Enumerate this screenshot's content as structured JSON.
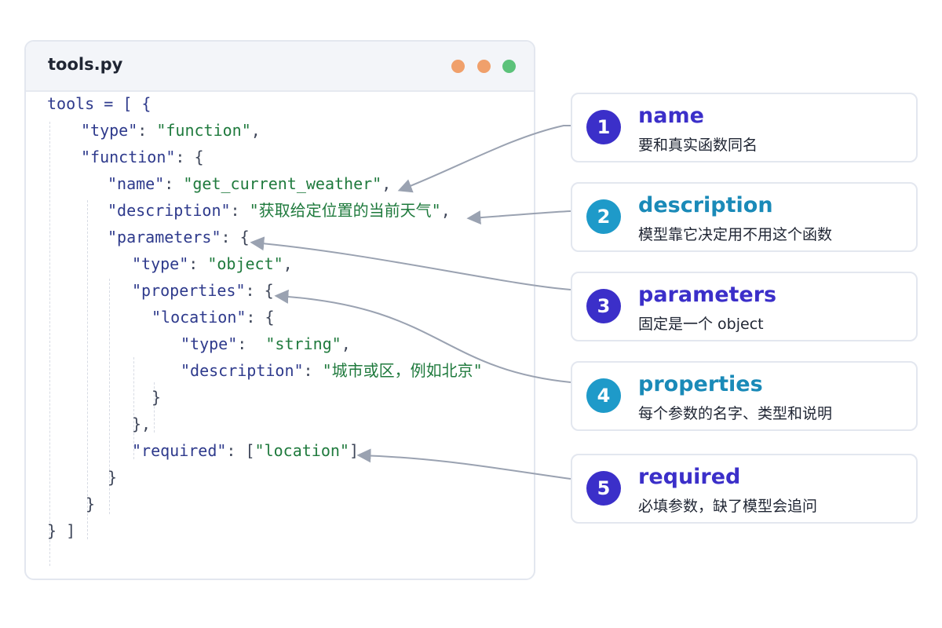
{
  "editor": {
    "filename": "tools.py",
    "window_dots": [
      "#f0a06b",
      "#f0a06b",
      "#5cc27a"
    ],
    "code_lines": [
      [
        {
          "t": "tools = [ {",
          "c": "key"
        }
      ],
      [
        {
          "t": "\"type\"",
          "c": "key"
        },
        {
          "t": ": ",
          "c": "pun"
        },
        {
          "t": "\"function\"",
          "c": "str"
        },
        {
          "t": ",",
          "c": "pun"
        }
      ],
      [
        {
          "t": "\"function\"",
          "c": "key"
        },
        {
          "t": ": {",
          "c": "pun"
        }
      ],
      [
        {
          "t": "\"name\"",
          "c": "key"
        },
        {
          "t": ": ",
          "c": "pun"
        },
        {
          "t": "\"get_current_weather\"",
          "c": "str"
        },
        {
          "t": ",",
          "c": "pun"
        }
      ],
      [
        {
          "t": "\"description\"",
          "c": "key"
        },
        {
          "t": ": ",
          "c": "pun"
        },
        {
          "t": "\"获取给定位置的当前天气\"",
          "c": "str"
        },
        {
          "t": ",",
          "c": "pun"
        }
      ],
      [
        {
          "t": "\"parameters\"",
          "c": "key"
        },
        {
          "t": ": {",
          "c": "pun"
        }
      ],
      [
        {
          "t": "\"type\"",
          "c": "key"
        },
        {
          "t": ": ",
          "c": "pun"
        },
        {
          "t": "\"object\"",
          "c": "str"
        },
        {
          "t": ",",
          "c": "pun"
        }
      ],
      [
        {
          "t": "\"properties\"",
          "c": "key"
        },
        {
          "t": ": {",
          "c": "pun"
        }
      ],
      [
        {
          "t": "\"location\"",
          "c": "key"
        },
        {
          "t": ": {",
          "c": "pun"
        }
      ],
      [
        {
          "t": "\"type\"",
          "c": "key"
        },
        {
          "t": ":  ",
          "c": "pun"
        },
        {
          "t": "\"string\"",
          "c": "str"
        },
        {
          "t": ",",
          "c": "pun"
        }
      ],
      [
        {
          "t": "\"description\"",
          "c": "key"
        },
        {
          "t": ": ",
          "c": "pun"
        },
        {
          "t": "\"城市或区，例如北京\"",
          "c": "str"
        }
      ],
      [
        {
          "t": "}",
          "c": "pun"
        }
      ],
      [
        {
          "t": "},",
          "c": "pun"
        }
      ],
      [
        {
          "t": "\"required\"",
          "c": "key"
        },
        {
          "t": ": [",
          "c": "pun"
        },
        {
          "t": "\"location\"",
          "c": "str"
        },
        {
          "t": "]",
          "c": "pun"
        }
      ],
      [
        {
          "t": "}",
          "c": "pun"
        }
      ],
      [
        {
          "t": "}",
          "c": "pun"
        }
      ],
      [
        {
          "t": "} ]",
          "c": "pun"
        }
      ]
    ]
  },
  "callouts": [
    {
      "number": "1",
      "title": "name",
      "description": "要和真实函数同名",
      "color": "#3b2fc9",
      "title_color": "#3b2fc9"
    },
    {
      "number": "2",
      "title": "description",
      "description": "模型靠它决定用不用这个函数",
      "color": "#1e9ac9",
      "title_color": "#1a8ab8"
    },
    {
      "number": "3",
      "title": "parameters",
      "description": "固定是一个 object",
      "color": "#3b2fc9",
      "title_color": "#3b2fc9"
    },
    {
      "number": "4",
      "title": "properties",
      "description": "每个参数的名字、类型和说明",
      "color": "#1e9ac9",
      "title_color": "#1a8ab8"
    },
    {
      "number": "5",
      "title": "required",
      "description": "必填参数，缺了模型会追问",
      "color": "#3b2fc9",
      "title_color": "#3b2fc9"
    }
  ],
  "connector_color": "#9aa2b1"
}
